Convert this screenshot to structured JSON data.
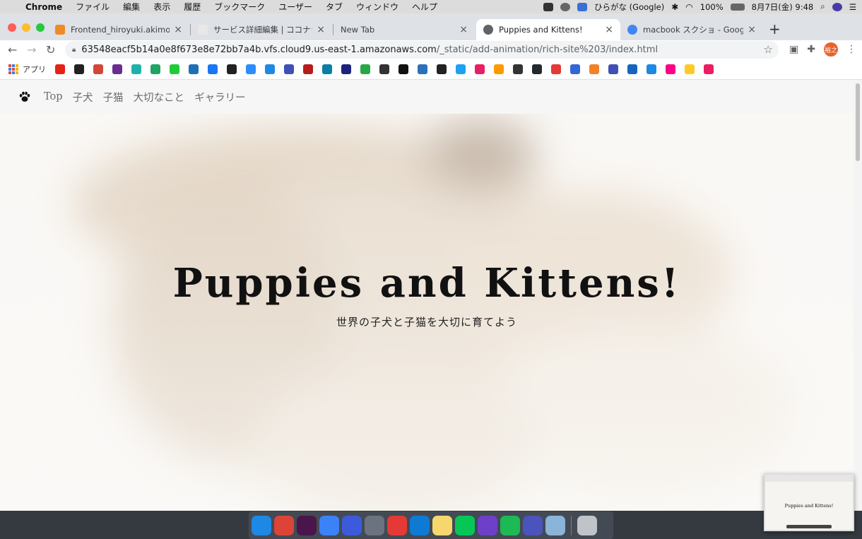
{
  "menubar": {
    "app_name": "Chrome",
    "items": [
      "ファイル",
      "編集",
      "表示",
      "履歴",
      "ブックマーク",
      "ユーザー",
      "タブ",
      "ウィンドウ",
      "ヘルプ"
    ],
    "input_method": "ひらがな (Google)",
    "battery": "100%",
    "datetime": "8月7日(金)  9:48"
  },
  "tabs": [
    {
      "title": "Frontend_hiroyuki.akimoto - AW",
      "favicon_color": "#f08a24",
      "active": false
    },
    {
      "title": "サービス詳細編集 | ココナラ",
      "favicon_color": "#e8e8e8",
      "active": false
    },
    {
      "title": "New Tab",
      "favicon_color": "",
      "active": false
    },
    {
      "title": "Puppies and Kittens!",
      "favicon_color": "#5f6368",
      "active": true
    },
    {
      "title": "macbook スクショ - Google 検索",
      "favicon_color": "#4285f4",
      "active": false
    }
  ],
  "address": {
    "host": "63548eacf5b14a0e8f673e8e72bb7a4b.vfs.cloud9.us-east-1.amazonaws.com",
    "path": "/_static/add-animation/rich-site%203/index.html"
  },
  "profile_initials": "裕之",
  "bookmarks": {
    "apps_label": "アプリ",
    "icon_colors": [
      "#e62117",
      "#222222",
      "#d44638",
      "#6a2c91",
      "#20b2aa",
      "#1fa463",
      "#1ecc3a",
      "#1d6fb8",
      "#1877f2",
      "#222222",
      "#2d8cff",
      "#1e88e5",
      "#3f51b5",
      "#b71c1c",
      "#0a7ea4",
      "#1a237e",
      "#28a745",
      "#333333",
      "#111111",
      "#2c6fbb",
      "#222222",
      "#1da1f2",
      "#e91e63",
      "#ff9900",
      "#333333",
      "#24292e",
      "#e53935",
      "#3367d6",
      "#f48024",
      "#3f51b5",
      "#1565c0",
      "#1e88e5",
      "#ff0084",
      "#ffca28",
      "#e91e63"
    ]
  },
  "site": {
    "nav": [
      "Top",
      "子犬",
      "子猫",
      "大切なこと",
      "ギャラリー"
    ],
    "hero_title": "Puppies and Kittens!",
    "hero_subtitle": "世界の子犬と子猫を大切に育てよう"
  },
  "dock": {
    "app_colors": [
      "#1e88e5",
      "#db4437",
      "#4a154b",
      "#3b82f6",
      "#3b5bdb",
      "#6b7280",
      "#e53935",
      "#0e7ad3",
      "#f5d76e",
      "#06c755",
      "#6e40c9",
      "#1db954",
      "#4b53bc",
      "#8ab4d8",
      "#c0c4c8"
    ]
  },
  "thumbnail": {
    "title": "Puppies and Kittens!"
  }
}
